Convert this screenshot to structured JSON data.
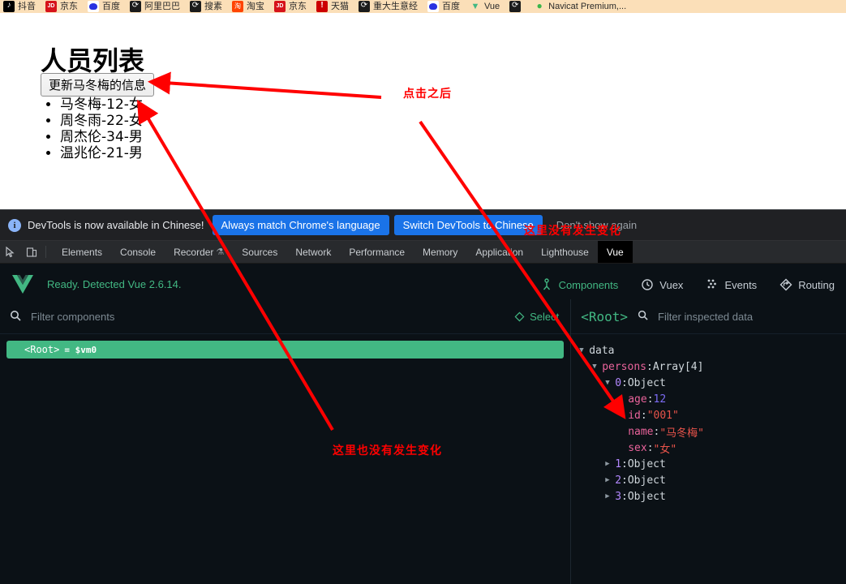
{
  "bookmarks": [
    {
      "label": "抖音",
      "icon": "douyin-icon",
      "style": "ico-douyin"
    },
    {
      "label": "京东",
      "icon": "jd-icon",
      "style": "ico-jd"
    },
    {
      "label": "百度",
      "icon": "baidu-icon",
      "style": "ico-baidu"
    },
    {
      "label": "阿里巴巴",
      "icon": "alibaba-icon",
      "style": "ico-dark"
    },
    {
      "label": "搜素",
      "icon": "search-bookmark-icon",
      "style": "ico-dark"
    },
    {
      "label": "淘宝",
      "icon": "taobao-icon",
      "style": "ico-taobao"
    },
    {
      "label": "京东",
      "icon": "jd-icon",
      "style": "ico-jd"
    },
    {
      "label": "天猫",
      "icon": "tmall-icon",
      "style": "ico-red"
    },
    {
      "label": "重大生意经",
      "icon": "dark-bookmark-icon",
      "style": "ico-dark"
    },
    {
      "label": "百度",
      "icon": "baidu-icon",
      "style": "ico-baidu"
    },
    {
      "label": "Vue",
      "icon": "vue-icon",
      "style": "ico-vue"
    },
    {
      "label": "",
      "icon": "dark-bookmark-icon",
      "style": "ico-dark"
    },
    {
      "label": "Navicat Premium,...",
      "icon": "navicat-icon",
      "style": "ico-navicat"
    }
  ],
  "page": {
    "title": "人员列表",
    "update_button": "更新马冬梅的信息",
    "persons": [
      "马冬梅-12-女",
      "周冬雨-22-女",
      "周杰伦-34-男",
      "温兆伦-21-男"
    ]
  },
  "annotations": [
    {
      "text": "点击之后"
    },
    {
      "text": "这里没有发生变化"
    },
    {
      "text": "这里也没有发生变化"
    }
  ],
  "devtools": {
    "notice": {
      "message": "DevTools is now available in Chinese!",
      "primary_button": "Always match Chrome's language",
      "secondary_button": "Switch DevTools to Chinese",
      "dismiss_button": "Don't show again"
    },
    "tools": [
      {
        "name": "inspect-element-icon"
      },
      {
        "name": "device-toolbar-icon"
      }
    ],
    "tabs": [
      {
        "label": "Elements",
        "active": false
      },
      {
        "label": "Console",
        "active": false
      },
      {
        "label": "Recorder",
        "active": false,
        "experimental": true
      },
      {
        "label": "Sources",
        "active": false
      },
      {
        "label": "Network",
        "active": false
      },
      {
        "label": "Performance",
        "active": false
      },
      {
        "label": "Memory",
        "active": false
      },
      {
        "label": "Application",
        "active": false
      },
      {
        "label": "Lighthouse",
        "active": false
      },
      {
        "label": "Vue",
        "active": true
      }
    ]
  },
  "vue_panel": {
    "status": "Ready. Detected Vue 2.6.14.",
    "nav_tabs": [
      {
        "label": "Components",
        "icon": "components-icon",
        "active": true
      },
      {
        "label": "Vuex",
        "icon": "vuex-icon",
        "active": false
      },
      {
        "label": "Events",
        "icon": "events-icon",
        "active": false
      },
      {
        "label": "Routing",
        "icon": "routing-icon",
        "active": false
      }
    ],
    "filter_placeholder": "Filter components",
    "select_label": "Select",
    "component_tree": [
      {
        "tag": "<Root>",
        "vm": "= $vm0",
        "selected": true
      }
    ],
    "inspected_root": "<Root>",
    "inspect_filter_placeholder": "Filter inspected data",
    "data_tree": [
      {
        "indent": 0,
        "arrow": "open",
        "kind": "group",
        "text": "data"
      },
      {
        "indent": 1,
        "arrow": "open",
        "kind": "key",
        "key": "persons",
        "sep": ": ",
        "value": "Array[4]",
        "vkind": "type"
      },
      {
        "indent": 2,
        "arrow": "open",
        "kind": "index",
        "key": "0",
        "sep": ": ",
        "value": "Object",
        "vkind": "type"
      },
      {
        "indent": 3,
        "arrow": "none",
        "kind": "key",
        "key": "age",
        "sep": ": ",
        "value": "12",
        "vkind": "num"
      },
      {
        "indent": 3,
        "arrow": "none",
        "kind": "key",
        "key": "id",
        "sep": ": ",
        "value": "\"001\"",
        "vkind": "str"
      },
      {
        "indent": 3,
        "arrow": "none",
        "kind": "key",
        "key": "name",
        "sep": ": ",
        "value": "\"马冬梅\"",
        "vkind": "str"
      },
      {
        "indent": 3,
        "arrow": "none",
        "kind": "key",
        "key": "sex",
        "sep": ": ",
        "value": "\"女\"",
        "vkind": "str"
      },
      {
        "indent": 2,
        "arrow": "closed",
        "kind": "index",
        "key": "1",
        "sep": ": ",
        "value": "Object",
        "vkind": "type"
      },
      {
        "indent": 2,
        "arrow": "closed",
        "kind": "index",
        "key": "2",
        "sep": ": ",
        "value": "Object",
        "vkind": "type"
      },
      {
        "indent": 2,
        "arrow": "closed",
        "kind": "index",
        "key": "3",
        "sep": ": ",
        "value": "Object",
        "vkind": "type"
      }
    ]
  },
  "colors": {
    "bookmark_bar": "#fbdfb8",
    "vue_green": "#42b883",
    "devtools_bg": "#202124",
    "vue_panel_bg": "#0b1116",
    "accent_blue": "#1a73e8",
    "annotation_red": "#ff0000"
  }
}
